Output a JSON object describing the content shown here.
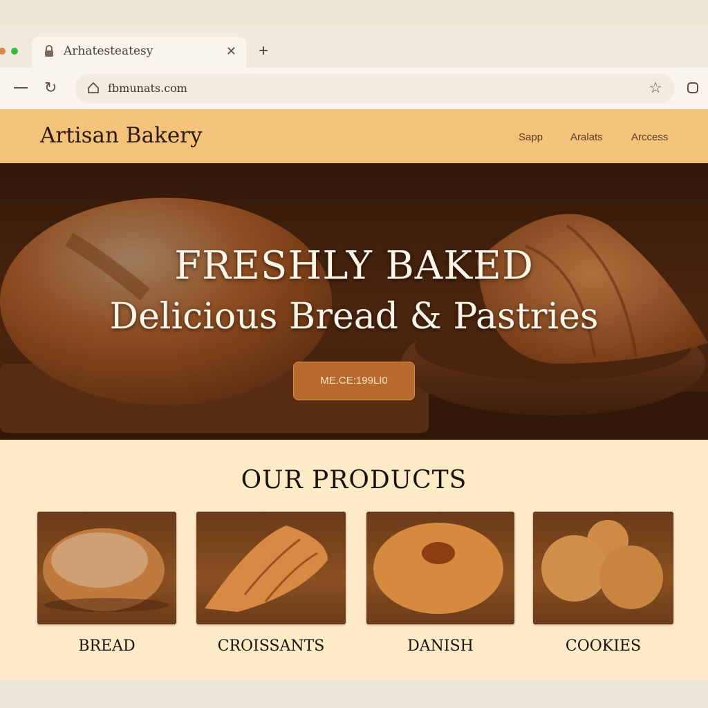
{
  "browser": {
    "tab_title": "Arhatesteatesy",
    "url": "fbmunats.com",
    "window_dot_colors": [
      "#e0874a",
      "#2fbf3a"
    ]
  },
  "site": {
    "brand": "Artisan Bakery",
    "nav": [
      "Sapp",
      "Aralats",
      "Arccess"
    ]
  },
  "hero": {
    "title": "FRESHLY BAKED",
    "subtitle": "Delicious Bread & Pastries",
    "cta_label": "ME.CE:199LI0"
  },
  "products": {
    "heading": "OUR PRODUCTS",
    "items": [
      {
        "label": "BREAD"
      },
      {
        "label": "CROISSANTS"
      },
      {
        "label": "DANISH"
      },
      {
        "label": "COOKIES"
      }
    ]
  },
  "colors": {
    "header_bg": "#f5c27a",
    "products_bg": "#fdebc8",
    "cta_bg": "#b86a2e"
  },
  "icons": [
    "lock-icon",
    "close-icon",
    "plus-icon",
    "minimize-icon",
    "reload-icon",
    "home-icon",
    "star-icon",
    "extension-icon"
  ]
}
